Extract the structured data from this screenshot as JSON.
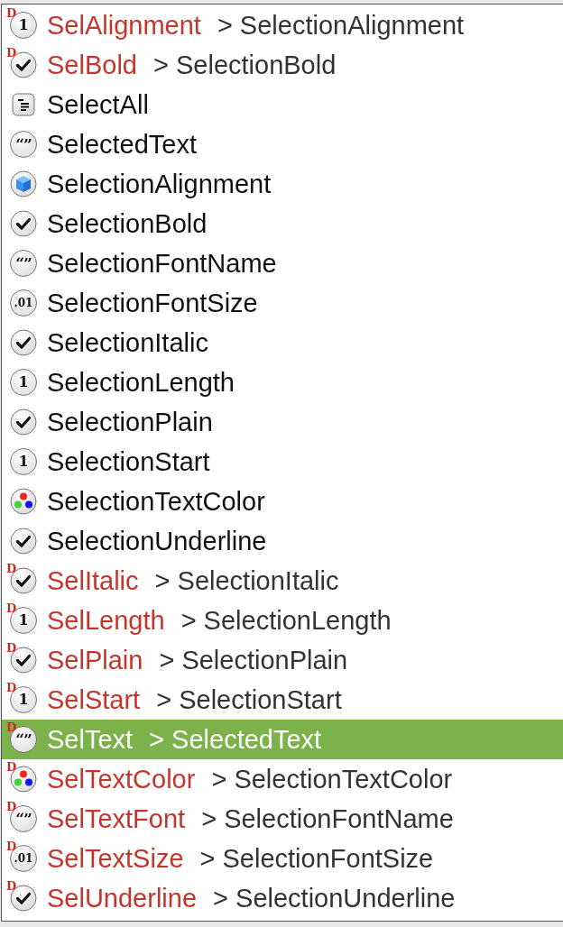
{
  "items": [
    {
      "name": "SelAlignment",
      "target": "> SelectionAlignment",
      "icon": {
        "kind": "integer",
        "glyph": "1"
      },
      "deprecated": true,
      "badge": "D",
      "selected": false
    },
    {
      "name": "SelBold",
      "target": "> SelectionBold",
      "icon": {
        "kind": "boolean"
      },
      "deprecated": true,
      "badge": "D",
      "selected": false
    },
    {
      "name": "SelectAll",
      "icon": {
        "kind": "method"
      },
      "deprecated": false,
      "selected": false
    },
    {
      "name": "SelectedText",
      "icon": {
        "kind": "string",
        "glyph": "“”"
      },
      "deprecated": false,
      "selected": false
    },
    {
      "name": "SelectionAlignment",
      "icon": {
        "kind": "object"
      },
      "deprecated": false,
      "selected": false
    },
    {
      "name": "SelectionBold",
      "icon": {
        "kind": "boolean"
      },
      "deprecated": false,
      "selected": false
    },
    {
      "name": "SelectionFontName",
      "icon": {
        "kind": "string",
        "glyph": "“”"
      },
      "deprecated": false,
      "selected": false
    },
    {
      "name": "SelectionFontSize",
      "icon": {
        "kind": "double",
        "glyph": ".01"
      },
      "deprecated": false,
      "selected": false
    },
    {
      "name": "SelectionItalic",
      "icon": {
        "kind": "boolean"
      },
      "deprecated": false,
      "selected": false
    },
    {
      "name": "SelectionLength",
      "icon": {
        "kind": "integer",
        "glyph": "1"
      },
      "deprecated": false,
      "selected": false
    },
    {
      "name": "SelectionPlain",
      "icon": {
        "kind": "boolean"
      },
      "deprecated": false,
      "selected": false
    },
    {
      "name": "SelectionStart",
      "icon": {
        "kind": "integer",
        "glyph": "1"
      },
      "deprecated": false,
      "selected": false
    },
    {
      "name": "SelectionTextColor",
      "icon": {
        "kind": "color"
      },
      "deprecated": false,
      "selected": false
    },
    {
      "name": "SelectionUnderline",
      "icon": {
        "kind": "boolean"
      },
      "deprecated": false,
      "selected": false
    },
    {
      "name": "SelItalic",
      "target": "> SelectionItalic",
      "icon": {
        "kind": "boolean"
      },
      "deprecated": true,
      "badge": "D",
      "selected": false
    },
    {
      "name": "SelLength",
      "target": "> SelectionLength",
      "icon": {
        "kind": "integer",
        "glyph": "1"
      },
      "deprecated": true,
      "badge": "D",
      "selected": false
    },
    {
      "name": "SelPlain",
      "target": "> SelectionPlain",
      "icon": {
        "kind": "boolean"
      },
      "deprecated": true,
      "badge": "D",
      "selected": false
    },
    {
      "name": "SelStart",
      "target": "> SelectionStart",
      "icon": {
        "kind": "integer",
        "glyph": "1"
      },
      "deprecated": true,
      "badge": "D",
      "selected": false
    },
    {
      "name": "SelText",
      "target": "> SelectedText",
      "icon": {
        "kind": "string",
        "glyph": "“”"
      },
      "deprecated": true,
      "badge": "D",
      "selected": true
    },
    {
      "name": "SelTextColor",
      "target": "> SelectionTextColor",
      "icon": {
        "kind": "color"
      },
      "deprecated": true,
      "badge": "D",
      "selected": false
    },
    {
      "name": "SelTextFont",
      "target": "> SelectionFontName",
      "icon": {
        "kind": "string",
        "glyph": "“”"
      },
      "deprecated": true,
      "badge": "D",
      "selected": false
    },
    {
      "name": "SelTextSize",
      "target": "> SelectionFontSize",
      "icon": {
        "kind": "double",
        "glyph": ".01"
      },
      "deprecated": true,
      "badge": "D",
      "selected": false
    },
    {
      "name": "SelUnderline",
      "target": "> SelectionUnderline",
      "icon": {
        "kind": "boolean"
      },
      "deprecated": true,
      "badge": "D",
      "selected": false
    }
  ]
}
